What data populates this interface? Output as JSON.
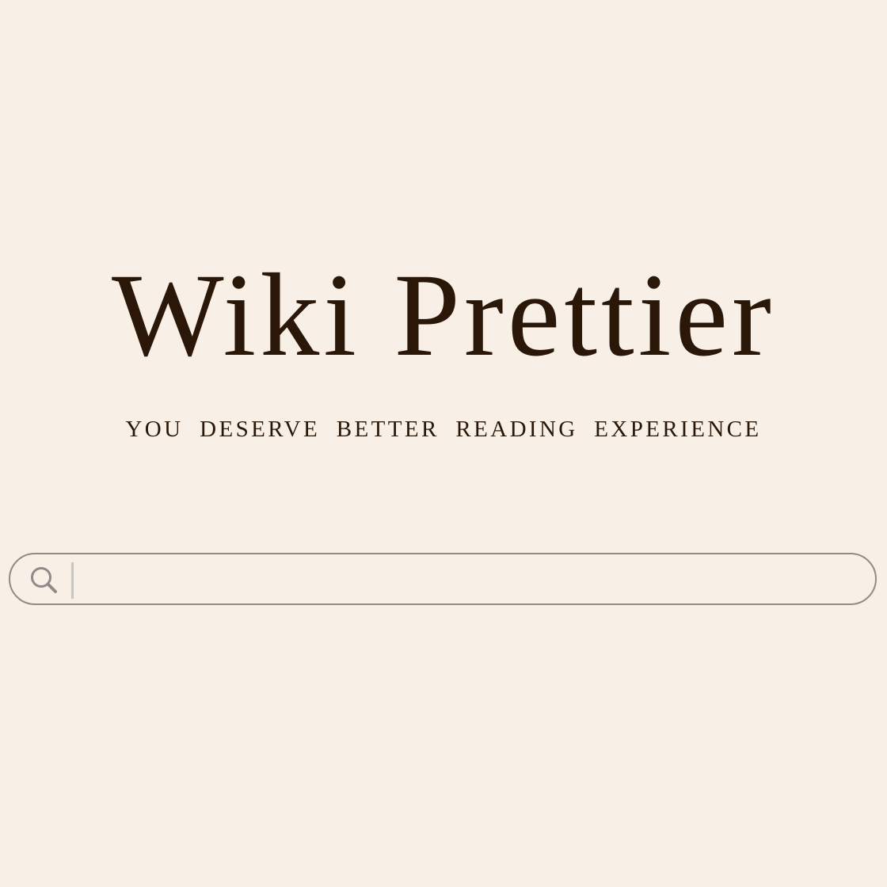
{
  "hero": {
    "title": "Wiki Prettier",
    "tagline": "YOU DESERVE BETTER READING EXPERIENCE"
  },
  "search": {
    "value": "",
    "placeholder": "",
    "icon": "search-icon"
  },
  "colors": {
    "background": "#f8f0e7",
    "text": "#2a1707",
    "search_border": "#8f8b88",
    "caret": "#c9c5c1"
  }
}
